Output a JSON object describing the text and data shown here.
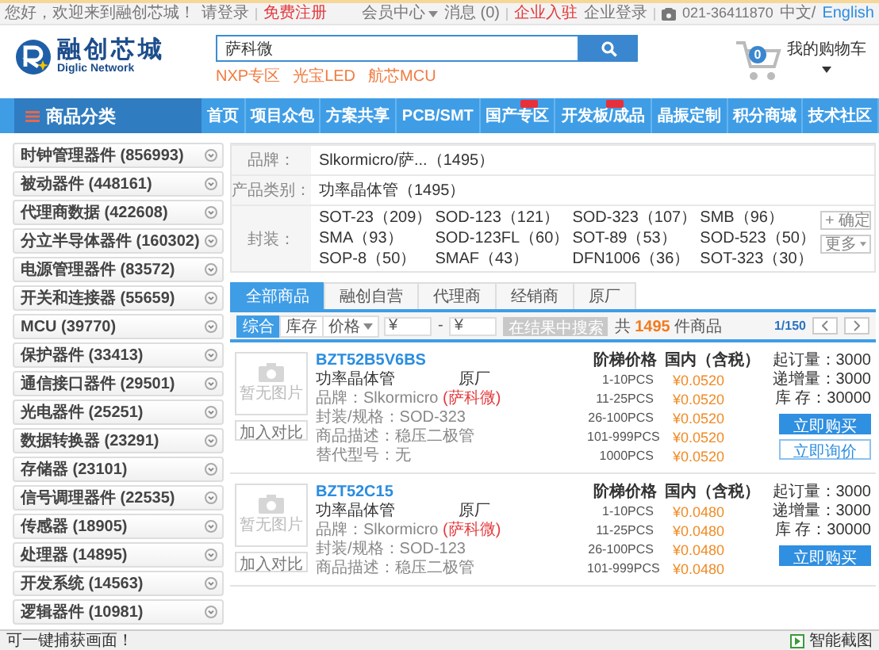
{
  "top_bar": {
    "greeting": "您好，欢迎来到融创芯城！",
    "login": "请登录",
    "register": "免费注册",
    "member_center": "会员中心",
    "messages": "消息 (0)",
    "enterprise_join": "企业入驻",
    "enterprise_login": "企业登录",
    "phone": "021-36411870",
    "lang_cn": "中文/",
    "lang_en": "English"
  },
  "header": {
    "logo_name": "融创芯城",
    "logo_sub": "Diglic Network",
    "search": {
      "value": "萨科微"
    },
    "hot_links": [
      "NXP专区",
      "光宝LED",
      "航芯MCU"
    ],
    "cart": {
      "count": "0",
      "label": "我的购物车"
    }
  },
  "nav": {
    "category_label": "商品分类",
    "items": [
      {
        "label": "首页",
        "badge": false
      },
      {
        "label": "项目众包",
        "badge": false
      },
      {
        "label": "方案共享",
        "badge": false
      },
      {
        "label": "PCB/SMT",
        "badge": false
      },
      {
        "label": "国产专区",
        "badge": true
      },
      {
        "label": "开发板/成品",
        "badge": true
      },
      {
        "label": "晶振定制",
        "badge": false
      },
      {
        "label": "积分商城",
        "badge": false
      },
      {
        "label": "技术社区",
        "badge": false
      }
    ]
  },
  "sidebar": {
    "items": [
      "时钟管理器件 (856993)",
      "被动器件 (448161)",
      "代理商数据 (422608)",
      "分立半导体器件 (160302)",
      "电源管理器件 (83572)",
      "开关和连接器 (55659)",
      "MCU (39770)",
      "保护器件 (33413)",
      "通信接口器件 (29501)",
      "光电器件 (25251)",
      "数据转换器 (23291)",
      "存储器 (23101)",
      "信号调理器件 (22535)",
      "传感器 (18905)",
      "处理器 (14895)",
      "开发系统 (14563)",
      "逻辑器件 (10981)"
    ]
  },
  "filter": {
    "rows": [
      {
        "label": "品牌：",
        "options": [
          "Slkormicro/萨...（1495）"
        ]
      },
      {
        "label": "产品类别：",
        "options": [
          "功率晶体管（1495）"
        ]
      },
      {
        "label": "封装：",
        "options": [
          "SOT-23（209）",
          "SOD-123（121）",
          "SOD-323（107）",
          "SMB（96）",
          "SMA（93）",
          "SOD-123FL（60）",
          "SOT-89（53）",
          "SOD-523（50）",
          "SOP-8（50）",
          "SMAF（43）",
          "DFN1006（36）",
          "SOT-323（30）"
        ],
        "actions": [
          {
            "label": "+ 确定",
            "kind": "plain"
          },
          {
            "label": "更多",
            "kind": "dropdown"
          }
        ]
      }
    ]
  },
  "results": {
    "tabs": [
      {
        "label": "全部商品",
        "selected": true
      },
      {
        "label": "融创自营",
        "selected": false
      },
      {
        "label": "代理商",
        "selected": false
      },
      {
        "label": "经销商",
        "selected": false
      },
      {
        "label": "原厂",
        "selected": false
      }
    ],
    "sort": [
      {
        "label": "综合",
        "selected": true,
        "kind": "plain"
      },
      {
        "label": "库存",
        "selected": false,
        "kind": "plain"
      },
      {
        "label": "价格",
        "selected": false,
        "kind": "dropdown"
      }
    ],
    "price_min": {
      "placeholder": "¥"
    },
    "separator": "-",
    "price_max": {
      "placeholder": "¥"
    },
    "search_in_results": "在结果中搜索",
    "total": "共 **1495** 件商品",
    "page": "1/150"
  },
  "products": [
    {
      "part": "BZT52B5V6BS",
      "image_text": "暂无图片",
      "compare": "加入对比",
      "category": "功率晶体管",
      "vendor": "原厂",
      "brand": "品牌：Slkormicro **(萨科微)**",
      "package": "封装/规格：SOD-323",
      "description": "商品描述：稳压二极管",
      "alternative": "替代型号：无",
      "price_header": [
        "阶梯价格",
        "国内（含税）"
      ],
      "prices": [
        {
          "qty": "1-10PCS",
          "price": "¥0.0520"
        },
        {
          "qty": "11-25PCS",
          "price": "¥0.0520"
        },
        {
          "qty": "26-100PCS",
          "price": "¥0.0520"
        },
        {
          "qty": "101-999PCS",
          "price": "¥0.0520"
        },
        {
          "qty": "1000PCS",
          "price": "¥0.0520"
        }
      ],
      "stock": [
        "起订量：3000",
        "递增量：3000",
        "库 存：30000"
      ],
      "buttons": [
        {
          "label": "立即购买",
          "kind": "primary"
        },
        {
          "label": "立即询价",
          "kind": "outline"
        }
      ]
    },
    {
      "part": "BZT52C15",
      "image_text": "暂无图片",
      "compare": "加入对比",
      "category": "功率晶体管",
      "vendor": "原厂",
      "brand": "品牌：Slkormicro **(萨科微)**",
      "package": "封装/规格：SOD-123",
      "description": "商品描述：稳压二极管",
      "price_header": [
        "阶梯价格",
        "国内（含税）"
      ],
      "prices": [
        {
          "qty": "1-10PCS",
          "price": "¥0.0480"
        },
        {
          "qty": "11-25PCS",
          "price": "¥0.0480"
        },
        {
          "qty": "26-100PCS",
          "price": "¥0.0480"
        },
        {
          "qty": "101-999PCS",
          "price": "¥0.0480"
        }
      ],
      "stock": [
        "起订量：3000",
        "递增量：3000",
        "库 存：30000"
      ],
      "buttons": [
        {
          "label": "立即购买",
          "kind": "primary"
        }
      ]
    }
  ],
  "status_bar": {
    "left": "可一键捕获画面！",
    "right": "智能截图"
  }
}
